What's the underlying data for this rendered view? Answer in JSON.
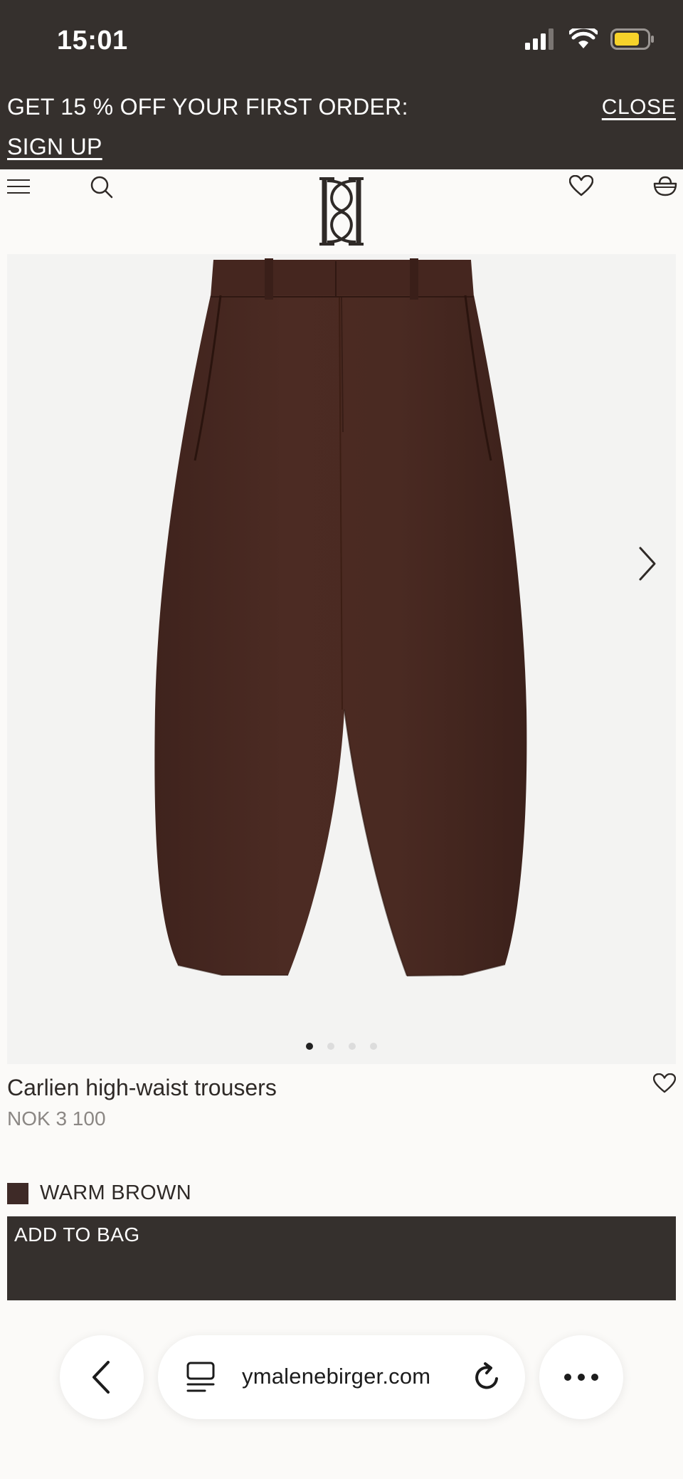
{
  "status_bar": {
    "time": "15:01"
  },
  "promo": {
    "text": "GET 15 % OFF YOUR FIRST ORDER:",
    "signup_label": "SIGN UP",
    "close_label": "CLOSE"
  },
  "header": {
    "icons": [
      "menu-icon",
      "search-icon",
      "brand-logo",
      "heart-icon",
      "bag-icon"
    ]
  },
  "product": {
    "name": "Carlien high-waist trousers",
    "price": "NOK 3 100",
    "color_name": "WARM BROWN",
    "color_hex": "#3e2a27",
    "image_count": 4,
    "active_image": 1
  },
  "cta": {
    "add_to_bag_label": "ADD TO BAG"
  },
  "browser": {
    "url": "ymalenebirger.com"
  },
  "colors": {
    "dark_bar": "#35302d",
    "page_bg": "#fbfaf8",
    "product_bg": "#f3f3f2",
    "trouser_brown": "#4a2a22"
  }
}
